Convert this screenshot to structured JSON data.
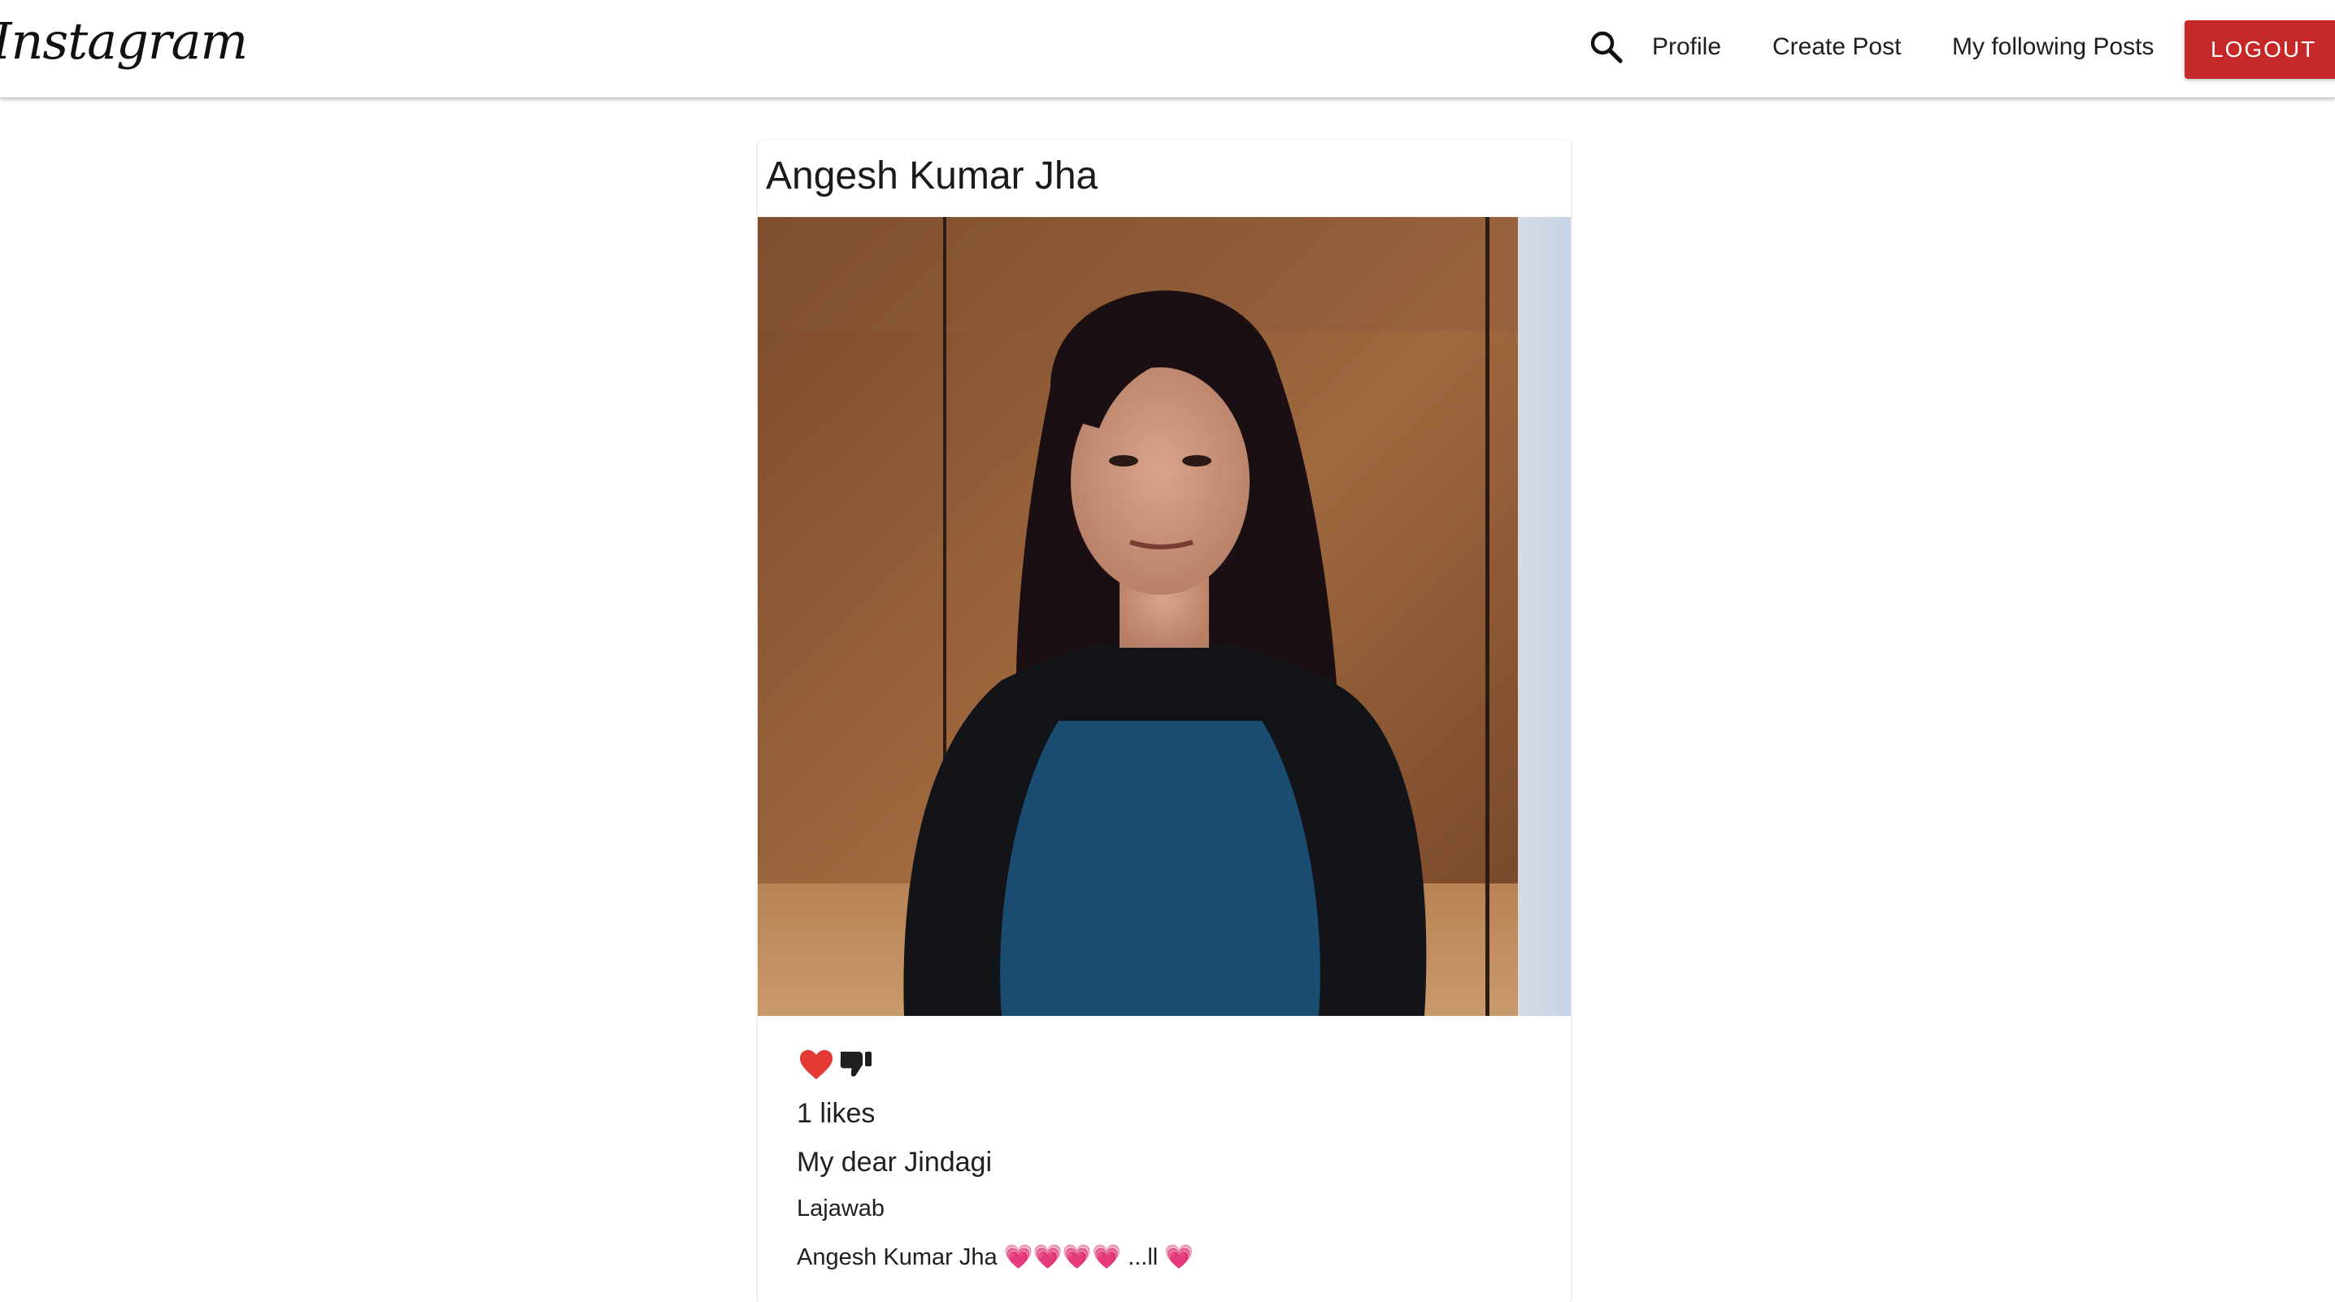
{
  "navbar": {
    "brand": "Instagram",
    "links": {
      "profile": "Profile",
      "create_post": "Create Post",
      "following_posts": "My following Posts"
    },
    "logout_label": "LOGOUT",
    "search_icon": "search-icon",
    "logout_color": "#c62828"
  },
  "post": {
    "author": "Angesh Kumar Jha",
    "image_icon": "photo",
    "like_icon": "heart-icon",
    "dislike_icon": "thumbs-down-icon",
    "likes": "1 likes",
    "title": "My dear Jindagi",
    "body": "Lajawab",
    "comment": "Angesh Kumar Jha 💗💗💗💗 ...ll 💗",
    "heart_color": "#e53935"
  }
}
